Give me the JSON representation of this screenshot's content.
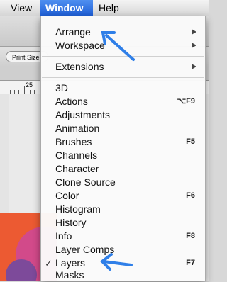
{
  "menubar": {
    "items": [
      {
        "label": "View"
      },
      {
        "label": "Window"
      },
      {
        "label": "Help"
      }
    ]
  },
  "optionsbar": {
    "print_label": "Print Size"
  },
  "ruler": {
    "mark": "25"
  },
  "window_menu": {
    "items": [
      {
        "label": "Arrange",
        "submenu": true
      },
      {
        "label": "Workspace",
        "submenu": true
      },
      {
        "label": "Extensions",
        "submenu": true
      },
      {
        "label": "3D"
      },
      {
        "label": "Actions",
        "shortcut": "⌥F9"
      },
      {
        "label": "Adjustments"
      },
      {
        "label": "Animation"
      },
      {
        "label": "Brushes",
        "shortcut": "F5"
      },
      {
        "label": "Channels"
      },
      {
        "label": "Character"
      },
      {
        "label": "Clone Source"
      },
      {
        "label": "Color",
        "shortcut": "F6"
      },
      {
        "label": "Histogram"
      },
      {
        "label": "History"
      },
      {
        "label": "Info",
        "shortcut": "F8"
      },
      {
        "label": "Layer Comps"
      },
      {
        "label": "Layers",
        "shortcut": "F7",
        "checked": true,
        "check_mark": "✓"
      },
      {
        "label": "Masks"
      }
    ]
  },
  "colors": {
    "menu_highlight": "#2a6ddf",
    "arrow_annotation": "#2f7fe8"
  }
}
